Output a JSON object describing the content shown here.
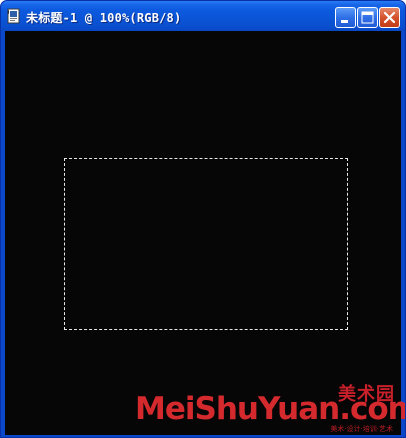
{
  "window": {
    "title": "未标题-1 @ 100%(RGB/8)"
  },
  "title_controls": {
    "minimize_icon": "minimize-icon",
    "maximize_icon": "maximize-icon",
    "close_icon": "close-icon"
  },
  "watermark": {
    "cn": "美术园",
    "brand_prefix": "MeiShuYuan",
    "brand_suffix": "com",
    "tagline": "美术·设计·培训·艺术"
  },
  "colors": {
    "titlebar": "#0a54d6",
    "canvas": "#060606",
    "selection": "#e8e8e8",
    "watermark": "#d42a2e"
  }
}
